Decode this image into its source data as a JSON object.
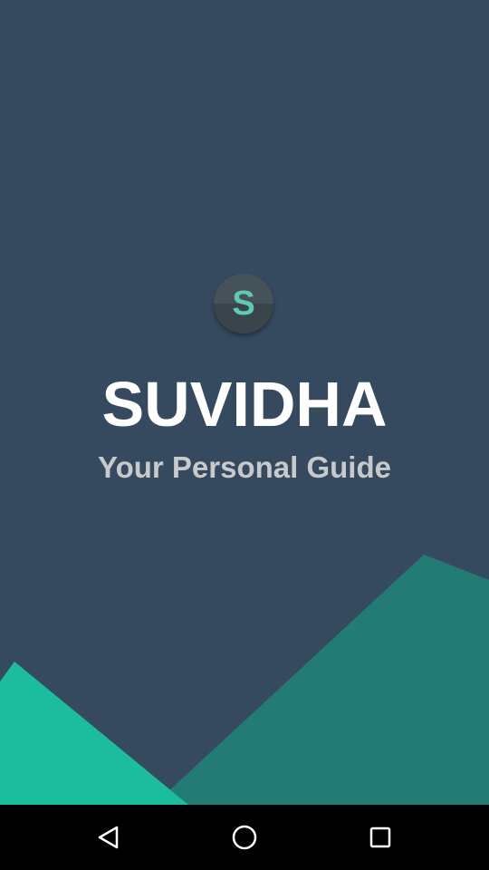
{
  "app": {
    "title": "SUVIDHA",
    "tagline": "Your Personal Guide",
    "logo_letter": "S"
  },
  "colors": {
    "background": "#364a5f",
    "mountain_dark": "#237c74",
    "mountain_light": "#1cbd9d",
    "logo_letter": "#5fc9b4",
    "title": "#ffffff",
    "tagline": "#c7c9cb"
  },
  "navbar": {
    "back_icon": "back-triangle-icon",
    "home_icon": "home-circle-icon",
    "recents_icon": "recents-square-icon"
  }
}
